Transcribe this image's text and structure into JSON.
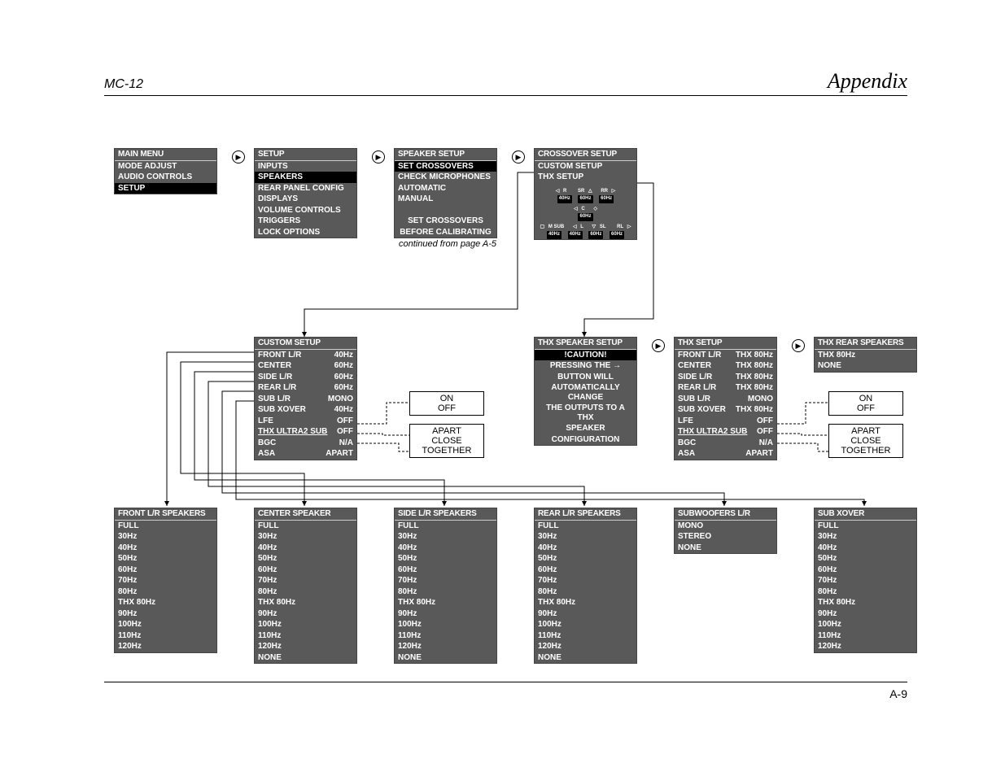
{
  "header": {
    "model": "MC-12",
    "title": "Appendix"
  },
  "footer": {
    "page": "A-9"
  },
  "note_continued": "continued from page A-5",
  "mainmenu": {
    "title": "MAIN MENU",
    "items": [
      "MODE ADJUST",
      "AUDIO CONTROLS",
      "SETUP"
    ],
    "hl": 2
  },
  "setup": {
    "title": "SETUP",
    "items": [
      "INPUTS",
      "SPEAKERS",
      "REAR PANEL CONFIG",
      "DISPLAYS",
      "VOLUME CONTROLS",
      "TRIGGERS",
      "LOCK OPTIONS"
    ],
    "hl": 1
  },
  "spsetup": {
    "title": "SPEAKER SETUP",
    "items": [
      "SET CROSSOVERS",
      "CHECK MICROPHONES",
      "AUTOMATIC",
      "MANUAL",
      "",
      "SET CROSSOVERS",
      "BEFORE CALIBRATING"
    ],
    "hl": 0
  },
  "xsetup": {
    "title": "CROSSOVER SETUP",
    "items": [
      "CUSTOM SETUP",
      "THX SETUP"
    ]
  },
  "diag_labels": {
    "r": "R",
    "sr": "SR",
    "rr": "RR",
    "c": "C",
    "msub": "M SUB",
    "l": "L",
    "sl": "SL",
    "rl": "RL"
  },
  "diag_hz": {
    "f": "40Hz",
    "s": "60Hz",
    "r": "60Hz",
    "c": "60Hz",
    "sub": "40Hz",
    "l": "40Hz",
    "sl": "60Hz",
    "rl": "60Hz"
  },
  "custom": {
    "title": "CUSTOM SETUP",
    "rows": [
      [
        "FRONT L/R",
        "40Hz"
      ],
      [
        "CENTER",
        "60Hz"
      ],
      [
        "SIDE L/R",
        "60Hz"
      ],
      [
        "REAR L/R",
        "60Hz"
      ],
      [
        "SUB L/R",
        "MONO"
      ],
      [
        "SUB XOVER",
        "40Hz"
      ],
      [
        "LFE",
        "OFF"
      ],
      [
        "THX ULTRA2 SUB",
        "OFF"
      ],
      [
        "BGC",
        "N/A"
      ],
      [
        "ASA",
        "APART"
      ]
    ]
  },
  "thxcaution": {
    "title": "THX SPEAKER SETUP",
    "sub": "!CAUTION!",
    "lines": [
      "PRESSING THE →",
      "BUTTON WILL",
      "AUTOMATICALLY CHANGE",
      "THE OUTPUTS TO A THX",
      "SPEAKER",
      "CONFIGURATION"
    ]
  },
  "thxsetup": {
    "title": "THX SETUP",
    "rows": [
      [
        "FRONT L/R",
        "THX 80Hz"
      ],
      [
        "CENTER",
        "THX 80Hz"
      ],
      [
        "SIDE L/R",
        "THX 80Hz"
      ],
      [
        "REAR L/R",
        "THX 80Hz"
      ],
      [
        "SUB L/R",
        "MONO"
      ],
      [
        "SUB XOVER",
        "THX 80Hz"
      ],
      [
        "LFE",
        "OFF"
      ],
      [
        "THX ULTRA2 SUB",
        "OFF"
      ],
      [
        "BGC",
        "N/A"
      ],
      [
        "ASA",
        "APART"
      ]
    ]
  },
  "thxrear": {
    "title": "THX REAR SPEAKERS",
    "items": [
      "THX 80Hz",
      "NONE"
    ]
  },
  "onoff1": {
    "items": [
      "ON",
      "OFF"
    ]
  },
  "onoff2": {
    "items": [
      "ON",
      "OFF"
    ]
  },
  "acct1": {
    "items": [
      "APART",
      "CLOSE",
      "TOGETHER"
    ]
  },
  "acct2": {
    "items": [
      "APART",
      "CLOSE",
      "TOGETHER"
    ]
  },
  "bottom": [
    {
      "title": "FRONT L/R SPEAKERS",
      "items": [
        "FULL",
        "30Hz",
        "40Hz",
        "50Hz",
        "60Hz",
        "70Hz",
        "80Hz",
        "THX 80Hz",
        "90Hz",
        "100Hz",
        "110Hz",
        "120Hz"
      ]
    },
    {
      "title": "CENTER SPEAKER",
      "items": [
        "FULL",
        "30Hz",
        "40Hz",
        "50Hz",
        "60Hz",
        "70Hz",
        "80Hz",
        "THX 80Hz",
        "90Hz",
        "100Hz",
        "110Hz",
        "120Hz",
        "NONE"
      ]
    },
    {
      "title": "SIDE L/R SPEAKERS",
      "items": [
        "FULL",
        "30Hz",
        "40Hz",
        "50Hz",
        "60Hz",
        "70Hz",
        "80Hz",
        "THX 80Hz",
        "90Hz",
        "100Hz",
        "110Hz",
        "120Hz",
        "NONE"
      ]
    },
    {
      "title": "REAR L/R SPEAKERS",
      "items": [
        "FULL",
        "30Hz",
        "40Hz",
        "50Hz",
        "60Hz",
        "70Hz",
        "80Hz",
        "THX 80Hz",
        "90Hz",
        "100Hz",
        "110Hz",
        "120Hz",
        "NONE"
      ]
    },
    {
      "title": "SUBWOOFERS L/R",
      "items": [
        "MONO",
        "STEREO",
        "NONE"
      ]
    },
    {
      "title": "SUB XOVER",
      "items": [
        "FULL",
        "30Hz",
        "40Hz",
        "50Hz",
        "60Hz",
        "70Hz",
        "80Hz",
        "THX 80Hz",
        "90Hz",
        "100Hz",
        "110Hz",
        "120Hz"
      ]
    }
  ]
}
